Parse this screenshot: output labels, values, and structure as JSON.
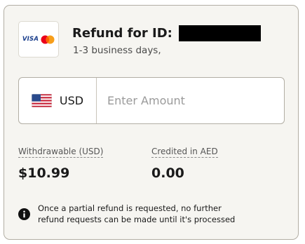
{
  "header": {
    "logo_text": "VISA",
    "title": "Refund for ID:",
    "subtitle": "1-3 business days,"
  },
  "amount": {
    "currency_code": "USD",
    "flag": "us-flag-icon",
    "value": "",
    "placeholder": "Enter Amount"
  },
  "stats": {
    "withdrawable_label": "Withdrawable (USD)",
    "withdrawable_value": "$10.99",
    "credited_label": "Credited in AED",
    "credited_value": "0.00"
  },
  "notice": {
    "icon": "info-icon",
    "line1": "Once a partial refund is requested, no further",
    "line2": "refund requests can be made until it's processed"
  },
  "colors": {
    "card_background": "#f6f5f1",
    "border": "#b2aea4",
    "visa_blue": "#1a3e8c",
    "mastercard_red": "#eb001b",
    "mastercard_orange": "#f79e1b"
  }
}
